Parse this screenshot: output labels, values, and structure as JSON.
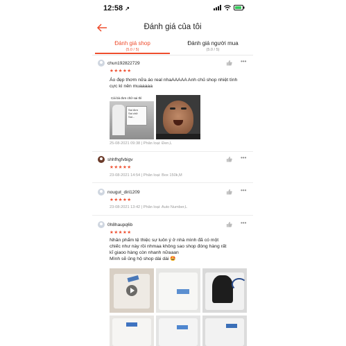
{
  "status": {
    "time": "12:58",
    "location_arrow": "↗"
  },
  "nav": {
    "title": "Đánh giá của tôi"
  },
  "tabs": [
    {
      "label": "Đánh giá shop",
      "sub": "(5.0 / 5)"
    },
    {
      "label": "Đánh giá người mua",
      "sub": "(5.0 / 5)"
    }
  ],
  "reviews": [
    {
      "user": "chun192822729",
      "stars": "★★★★★",
      "comment": "Áo đẹp thơm nữa áo real nhaAAAAA Anh chủ shop nhiệt tình cực kì nên muaaaaa",
      "meta": "25-08-2021 09:38 | Phân loại: Đen,L",
      "img1_caption": "Cái bà đơn chữ sai thì",
      "img1_sign": "Sai đơn\nSai chữ\nSai..."
    },
    {
      "user": "shhfhgfvbigv",
      "stars": "★★★★★",
      "meta": "23-08-2021 14:54 | Phân loại: Box 150k,M"
    },
    {
      "user": "nougut_diri1209",
      "stars": "★★★★★",
      "meta": "23-08-2021 13:42 | Phân loại: Auto Number,L"
    },
    {
      "user": "0h8haupq6b",
      "stars": "★★★★★",
      "comment_lines": [
        "Nhân phẩm tệ thiệc sự luôn ý ở nhà mình đã có một",
        "chiếc như này rồi nhmaa không sao shop đóng hàng rất",
        "kĩ giaoo hàng còn nhanh nữaaan",
        "Mình sẽ ủng hộ shop dài dài 🤩"
      ]
    }
  ],
  "colors": {
    "accent": "#ee4d2d",
    "muted": "#999999",
    "divider": "#ececec"
  },
  "icons": [
    "back-arrow-icon",
    "signal-icon",
    "wifi-icon",
    "battery-icon",
    "thumbs-up-icon",
    "more-icon",
    "play-icon"
  ]
}
